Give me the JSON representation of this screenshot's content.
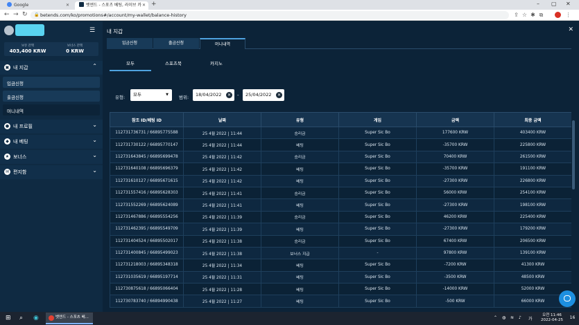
{
  "browser": {
    "tabs": [
      {
        "title": "Google"
      },
      {
        "title": "벳엔드 - 스포츠 베팅, 라이브 카"
      }
    ],
    "url": "betends.com/ko/promotions#/account/my-wallet/balance-history"
  },
  "sidebar": {
    "balances": [
      {
        "label": "보유 잔액",
        "value": "403,400 KRW"
      },
      {
        "label": "보너스 잔액",
        "value": "0 KRW"
      }
    ],
    "wallet": {
      "label": "내 지갑",
      "items": [
        "입금신청",
        "출금신청",
        "머니내역"
      ]
    },
    "groups": [
      {
        "label": "내 프로필"
      },
      {
        "label": "내 베팅"
      },
      {
        "label": "보너스"
      },
      {
        "label": "편지함"
      }
    ]
  },
  "main": {
    "title": "내 지갑",
    "tabs": [
      "입금신청",
      "출금신청",
      "머니내역"
    ],
    "subtabs": [
      "모두",
      "스포츠북",
      "카지노"
    ],
    "filters": {
      "type_label": "유형:",
      "type_value": "모두",
      "range_label": "범위:",
      "date_from": "18/04/2022",
      "date_to": "25/04/2022",
      "separator": "-"
    },
    "table": {
      "headers": [
        "참조 ID/베팅 ID",
        "날짜",
        "유형",
        "게임",
        "금액",
        "최종 금액"
      ],
      "rows": [
        [
          "112731736731 / 66895775588",
          "25 4월 2022 | 11:44",
          "승리금",
          "Super Sic Bo",
          "177600 KRW",
          "403400 KRW"
        ],
        [
          "112731730122 / 66895770147",
          "25 4월 2022 | 11:44",
          "베팅",
          "Super Sic Bo",
          "-35700 KRW",
          "225800 KRW"
        ],
        [
          "112731643845 / 66895699478",
          "25 4월 2022 | 11:42",
          "승리금",
          "Super Sic Bo",
          "70400 KRW",
          "261500 KRW"
        ],
        [
          "112731640108 / 66895696379",
          "25 4월 2022 | 11:42",
          "베팅",
          "Super Sic Bo",
          "-35700 KRW",
          "191100 KRW"
        ],
        [
          "112731610127 / 66895671615",
          "25 4월 2022 | 11:42",
          "베팅",
          "Super Sic Bo",
          "-27300 KRW",
          "226800 KRW"
        ],
        [
          "112731557416 / 66895628303",
          "25 4월 2022 | 11:41",
          "승리금",
          "Super Sic Bo",
          "56000 KRW",
          "254100 KRW"
        ],
        [
          "112731552269 / 66895624089",
          "25 4월 2022 | 11:41",
          "베팅",
          "Super Sic Bo",
          "-27300 KRW",
          "198100 KRW"
        ],
        [
          "112731467886 / 66895554256",
          "25 4월 2022 | 11:39",
          "승리금",
          "Super Sic Bo",
          "46200 KRW",
          "225400 KRW"
        ],
        [
          "112731462395 / 66895549709",
          "25 4월 2022 | 11:39",
          "베팅",
          "Super Sic Bo",
          "-27300 KRW",
          "179200 KRW"
        ],
        [
          "112731404524 / 66895502017",
          "25 4월 2022 | 11:38",
          "승리금",
          "Super Sic Bo",
          "67400 KRW",
          "206500 KRW"
        ],
        [
          "112731400845 / 66895499023",
          "25 4월 2022 | 11:38",
          "보너스 지급",
          "-",
          "97800 KRW",
          "139100 KRW"
        ],
        [
          "112731218003 / 66895348318",
          "25 4월 2022 | 11:34",
          "베팅",
          "Super Sic Bo",
          "-7200 KRW",
          "41300 KRW"
        ],
        [
          "112731035619 / 66895197714",
          "25 4월 2022 | 11:31",
          "베팅",
          "Super Sic Bo",
          "-3500 KRW",
          "48500 KRW"
        ],
        [
          "112730875618 / 66895066404",
          "25 4월 2022 | 11:28",
          "베팅",
          "Super Sic Bo",
          "-14000 KRW",
          "52000 KRW"
        ],
        [
          "112730783740 / 66894990438",
          "25 4월 2022 | 11:27",
          "베팅",
          "Super Sic Bo",
          "-500 KRW",
          "66000 KRW"
        ]
      ]
    }
  },
  "taskbar": {
    "app": "벳엔드 - 스포츠 베...",
    "time": "오전 11:46",
    "date": "2022-04-25",
    "notifications": "16"
  },
  "colors": {
    "background": "#0c2338",
    "sidebar": "#0f2a42",
    "accent": "#4fa3e0",
    "chat": "#1d8fe0"
  }
}
